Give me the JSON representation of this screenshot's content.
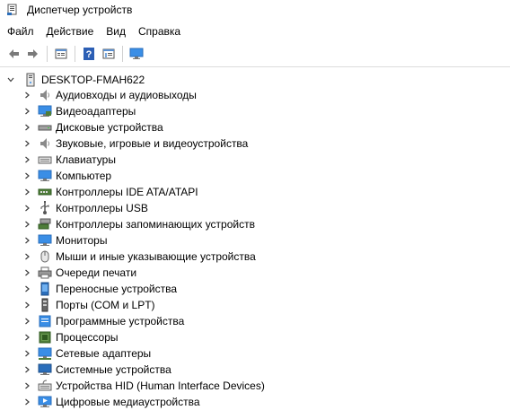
{
  "window": {
    "title": "Диспетчер устройств",
    "icon": "device-manager-icon"
  },
  "menu": [
    {
      "label": "Файл",
      "name": "menu-file"
    },
    {
      "label": "Действие",
      "name": "menu-action"
    },
    {
      "label": "Вид",
      "name": "menu-view"
    },
    {
      "label": "Справка",
      "name": "menu-help"
    }
  ],
  "toolbar": [
    {
      "name": "back-button",
      "icon": "back-arrow-icon"
    },
    {
      "name": "forward-button",
      "icon": "forward-arrow-icon"
    },
    {
      "sep": true
    },
    {
      "name": "properties-button",
      "icon": "properties-icon"
    },
    {
      "sep": true
    },
    {
      "name": "help-button",
      "icon": "help-icon"
    },
    {
      "name": "show-hide-console-tree-button",
      "icon": "console-tree-icon"
    },
    {
      "sep": true
    },
    {
      "name": "scan-hardware-button",
      "icon": "scan-monitor-icon"
    }
  ],
  "tree": {
    "root": {
      "label": "DESKTOP-FMAH622",
      "expanded": true,
      "icon": "computer-icon"
    },
    "items": [
      {
        "label": "Аудиовходы и аудиовыходы",
        "icon": "speaker-icon"
      },
      {
        "label": "Видеоадаптеры",
        "icon": "display-adapter-icon"
      },
      {
        "label": "Дисковые устройства",
        "icon": "disk-drive-icon"
      },
      {
        "label": "Звуковые, игровые и видеоустройства",
        "icon": "speaker-icon"
      },
      {
        "label": "Клавиатуры",
        "icon": "keyboard-icon"
      },
      {
        "label": "Компьютер",
        "icon": "monitor-icon"
      },
      {
        "label": "Контроллеры IDE ATA/ATAPI",
        "icon": "ide-controller-icon"
      },
      {
        "label": "Контроллеры USB",
        "icon": "usb-icon"
      },
      {
        "label": "Контроллеры запоминающих устройств",
        "icon": "storage-controller-icon"
      },
      {
        "label": "Мониторы",
        "icon": "monitor-icon"
      },
      {
        "label": "Мыши и иные указывающие устройства",
        "icon": "mouse-icon"
      },
      {
        "label": "Очереди печати",
        "icon": "printer-icon"
      },
      {
        "label": "Переносные устройства",
        "icon": "portable-device-icon"
      },
      {
        "label": "Порты (COM и LPT)",
        "icon": "port-icon"
      },
      {
        "label": "Программные устройства",
        "icon": "software-device-icon"
      },
      {
        "label": "Процессоры",
        "icon": "processor-icon"
      },
      {
        "label": "Сетевые адаптеры",
        "icon": "network-adapter-icon"
      },
      {
        "label": "Системные устройства",
        "icon": "system-device-icon"
      },
      {
        "label": "Устройства HID (Human Interface Devices)",
        "icon": "hid-icon"
      },
      {
        "label": "Цифровые медиаустройства",
        "icon": "media-device-icon"
      }
    ]
  },
  "colors": {
    "accent": "#1e6fc8",
    "monitor": "#3a8ee6",
    "chip": "#4f7d3a"
  }
}
